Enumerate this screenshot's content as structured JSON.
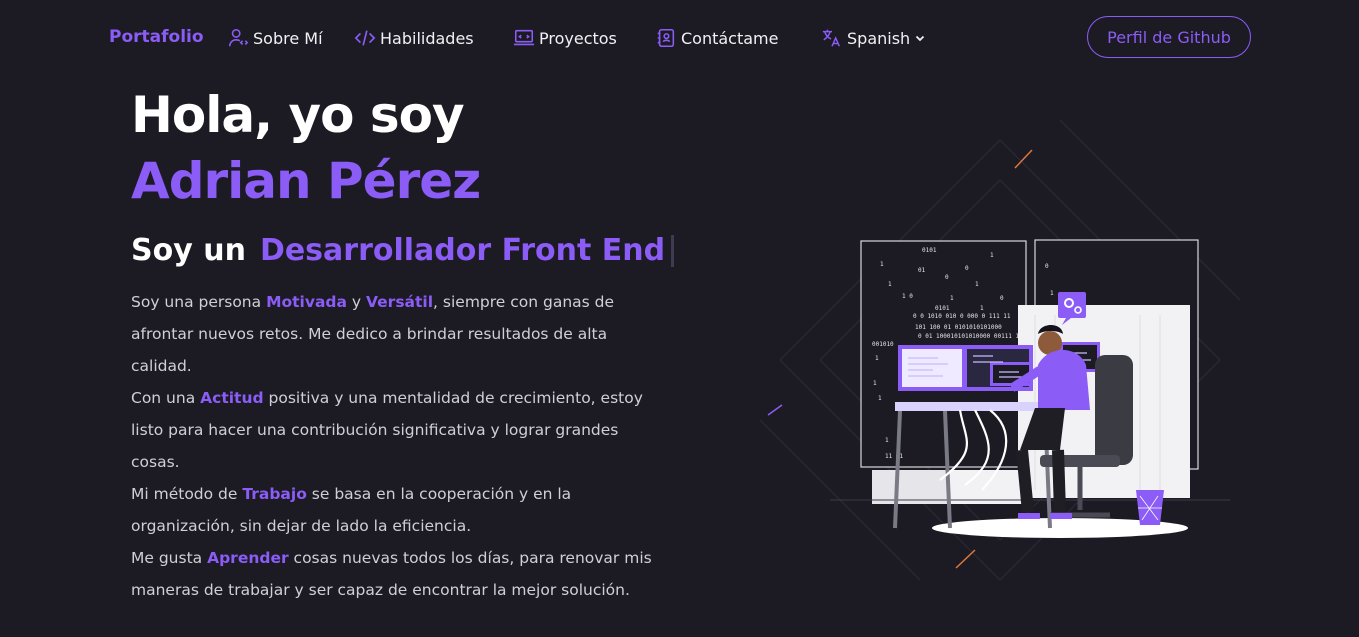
{
  "nav": {
    "brand": "Portafolio",
    "items": [
      {
        "label": "Sobre Mí",
        "icon": "user-icon"
      },
      {
        "label": "Habilidades",
        "icon": "code-icon"
      },
      {
        "label": "Proyectos",
        "icon": "laptop-icon"
      },
      {
        "label": "Contáctame",
        "icon": "contact-book-icon"
      },
      {
        "label": "Spanish",
        "icon": "translate-icon"
      }
    ],
    "github_button": "Perfil de Github"
  },
  "hero": {
    "greeting": "Hola, yo soy",
    "name": "Adrian Pérez",
    "role_prefix": "Soy un",
    "role": "Desarrollador Front End"
  },
  "bio": {
    "p1": {
      "a": "Soy una persona ",
      "h1": "Motivada",
      "b": " y ",
      "h2": "Versátil",
      "c": ", siempre con ganas de afrontar nuevos retos. Me dedico a brindar resultados de alta calidad."
    },
    "p2": {
      "a": "Con una ",
      "h1": "Actitud",
      "b": " positiva y una mentalidad de crecimiento, estoy listo para hacer una contribución significativa y lograr grandes cosas."
    },
    "p3": {
      "a": "Mi método de ",
      "h1": "Trabajo",
      "b": " se basa en la cooperación y en la organización, sin dejar de lado la eficiencia."
    },
    "p4": {
      "a": "Me gusta ",
      "h1": "Aprender",
      "b": " cosas nuevas todos los días, para renovar mis maneras de trabajar y ser capaz de encontrar la mejor solución."
    }
  },
  "colors": {
    "accent": "#8b5cf6",
    "background": "#1c1b24",
    "text": "#cfcfd6"
  }
}
